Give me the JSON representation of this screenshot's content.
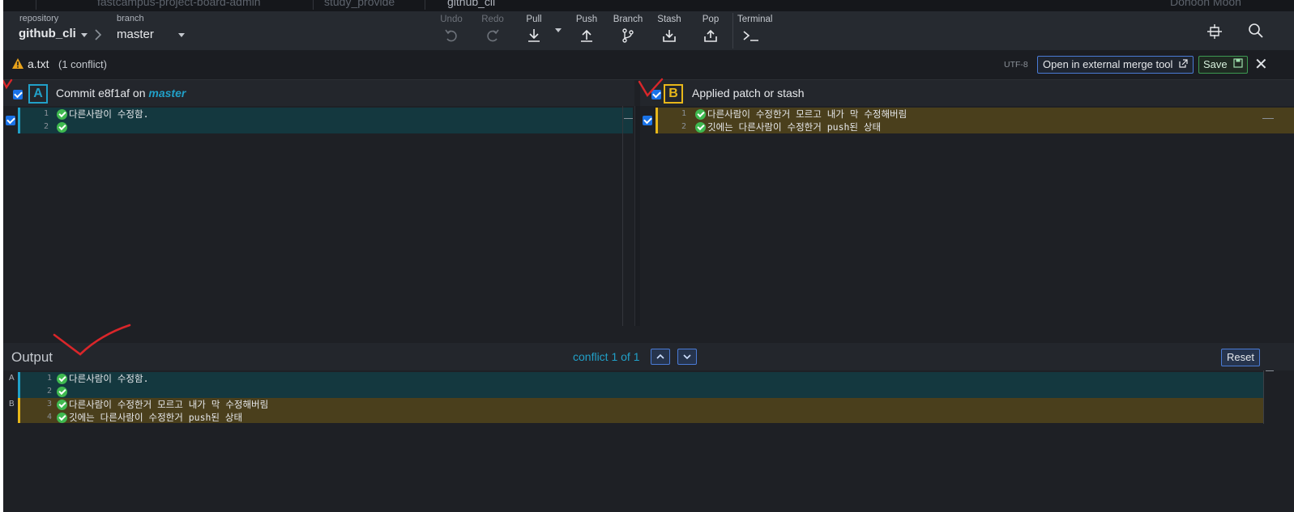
{
  "tabs": [
    "fastcampus-project-board-admin",
    "study_provide",
    "github_cli"
  ],
  "account": {
    "name": "Dohoon Moon"
  },
  "toolbar": {
    "repository_label": "repository",
    "repository": "github_cli",
    "branch_label": "branch",
    "branch": "master",
    "buttons": [
      {
        "label": "Undo",
        "icon": "undo-icon",
        "enabled": false
      },
      {
        "label": "Redo",
        "icon": "redo-icon",
        "enabled": false
      },
      {
        "label": "Pull",
        "icon": "pull-icon",
        "enabled": true
      },
      {
        "label": "Push",
        "icon": "push-icon",
        "enabled": true
      },
      {
        "label": "Branch",
        "icon": "branch-icon",
        "enabled": true
      },
      {
        "label": "Stash",
        "icon": "stash-icon",
        "enabled": true
      },
      {
        "label": "Pop",
        "icon": "pop-icon",
        "enabled": true
      },
      {
        "label": "Terminal",
        "icon": "terminal-icon",
        "enabled": true
      }
    ]
  },
  "conflict": {
    "file": "a.txt",
    "count_text": "(1 conflict)",
    "encoding": "UTF-8",
    "open_external": "Open in external merge tool",
    "save": "Save"
  },
  "pane_a": {
    "letter": "A",
    "title_prefix": "Commit e8f1af on",
    "branch": "master",
    "lines": [
      {
        "num": "1",
        "text": "다른사람이 수정함."
      },
      {
        "num": "2",
        "text": ""
      }
    ]
  },
  "pane_b": {
    "letter": "B",
    "title": "Applied patch or stash",
    "lines": [
      {
        "num": "1",
        "text": "다른사람이 수정한거 모르고 내가 막 수정해버림"
      },
      {
        "num": "2",
        "text": "깃에는 다른사람이 수정한거 push된 상태"
      }
    ]
  },
  "output": {
    "title": "Output",
    "nav_text": "conflict 1 of 1",
    "reset": "Reset",
    "lines": [
      {
        "marker": "A",
        "num": "1",
        "text": "다른사람이 수정함."
      },
      {
        "marker": "",
        "num": "2",
        "text": ""
      },
      {
        "marker": "B",
        "num": "3",
        "text": "다른사람이 수정한거 모르고 내가 막 수정해버림"
      },
      {
        "marker": "",
        "num": "4",
        "text": "깃에는 다른사람이 수정한거 push된 상태"
      }
    ]
  },
  "colors": {
    "a_line_bg": "#14383f",
    "a_accent": "#21a0c8",
    "b_line_bg": "#4a3f1c",
    "b_accent": "#e8b71a",
    "annotation_red": "#d9262a"
  }
}
